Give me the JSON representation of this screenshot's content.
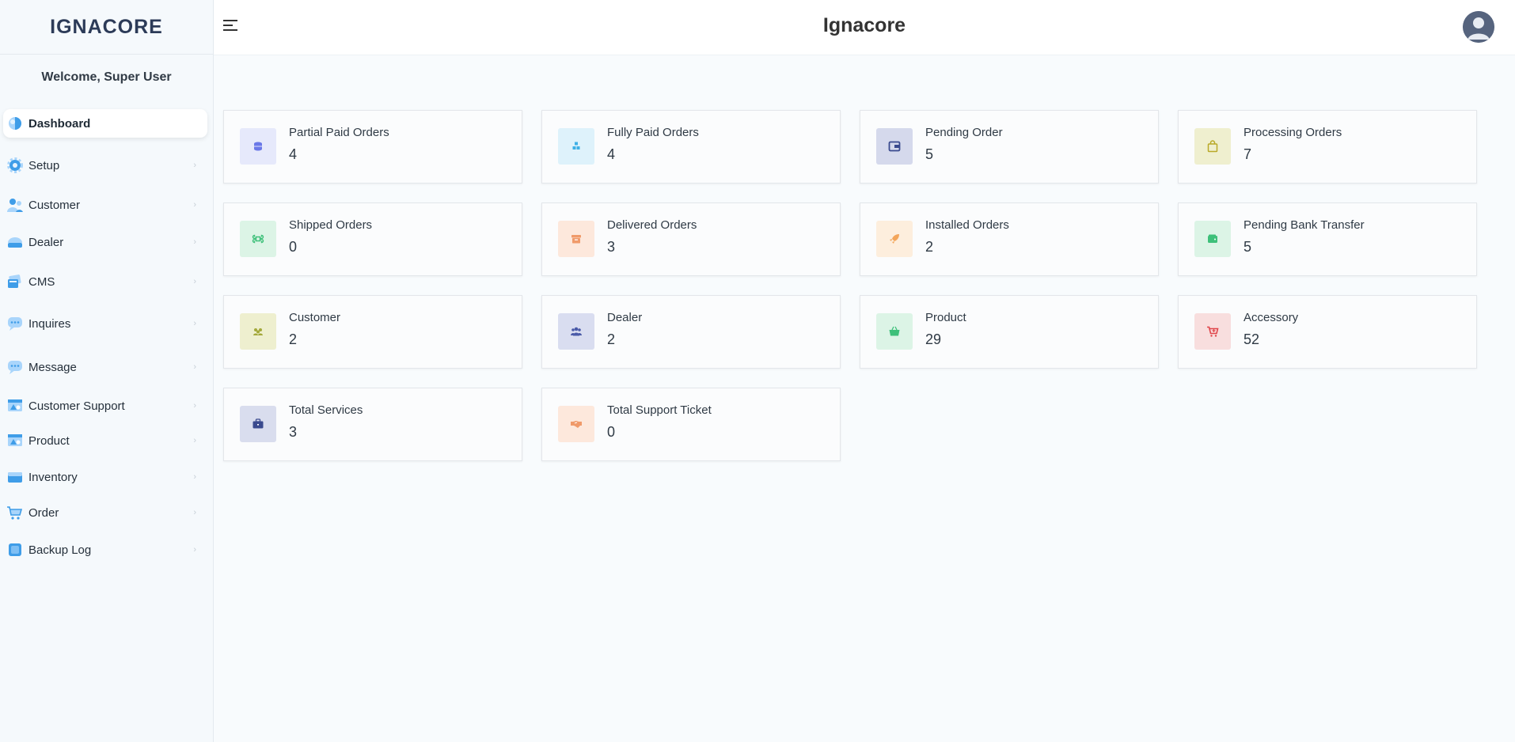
{
  "brand": {
    "logo_text": "IGNACORE",
    "app_title": "Ignacore"
  },
  "sidebar": {
    "welcome": "Welcome, Super User",
    "items": [
      {
        "label": "Dashboard",
        "icon": "dashboard-icon"
      },
      {
        "label": "Setup",
        "icon": "gear-icon"
      },
      {
        "label": "Customer",
        "icon": "customer-icon"
      },
      {
        "label": "Dealer",
        "icon": "dealer-icon"
      },
      {
        "label": "CMS",
        "icon": "cms-icon"
      },
      {
        "label": "Inquires",
        "icon": "chat-icon"
      },
      {
        "label": "Message",
        "icon": "message-icon"
      },
      {
        "label": "Customer Support",
        "icon": "support-icon"
      },
      {
        "label": "Product",
        "icon": "product-icon"
      },
      {
        "label": "Inventory",
        "icon": "inventory-icon"
      },
      {
        "label": "Order",
        "icon": "cart-icon"
      },
      {
        "label": "Backup Log",
        "icon": "backup-icon"
      }
    ]
  },
  "cards": [
    {
      "label": "Partial Paid Orders",
      "value": "4",
      "icon": "coins-icon",
      "color": "#6a78e8",
      "bg": "#e6e9fb"
    },
    {
      "label": "Fully Paid Orders",
      "value": "4",
      "icon": "cubes-icon",
      "color": "#3fb0e6",
      "bg": "#def2fb"
    },
    {
      "label": "Pending Order",
      "value": "5",
      "icon": "wallet-icon",
      "color": "#3a4a8e",
      "bg": "#d5d9ec"
    },
    {
      "label": "Processing Orders",
      "value": "7",
      "icon": "bag-icon",
      "color": "#b9a928",
      "bg": "#efefcf"
    },
    {
      "label": "Shipped Orders",
      "value": "0",
      "icon": "command-icon",
      "color": "#3ec07a",
      "bg": "#dcf4e6"
    },
    {
      "label": "Delivered Orders",
      "value": "3",
      "icon": "box-icon",
      "color": "#f09a6a",
      "bg": "#fde8dc"
    },
    {
      "label": "Installed Orders",
      "value": "2",
      "icon": "rocket-icon",
      "color": "#f3a55a",
      "bg": "#fdeedd"
    },
    {
      "label": "Pending Bank Transfer",
      "value": "5",
      "icon": "wallet-green-icon",
      "color": "#3ec07a",
      "bg": "#dcf4e6"
    },
    {
      "label": "Customer",
      "value": "2",
      "icon": "users-icon",
      "color": "#a3a83a",
      "bg": "#eeefcf"
    },
    {
      "label": "Dealer",
      "value": "2",
      "icon": "group-icon",
      "color": "#4a5aa8",
      "bg": "#d9ddf0"
    },
    {
      "label": "Product",
      "value": "29",
      "icon": "basket-icon",
      "color": "#3ec07a",
      "bg": "#dcf4e6"
    },
    {
      "label": "Accessory",
      "value": "52",
      "icon": "cart-plus-icon",
      "color": "#e0464b",
      "bg": "#f8dede"
    },
    {
      "label": "Total Services",
      "value": "3",
      "icon": "briefcase-icon",
      "color": "#3a4a8e",
      "bg": "#d9ddee"
    },
    {
      "label": "Total Support Ticket",
      "value": "0",
      "icon": "handshake-icon",
      "color": "#f09a6a",
      "bg": "#fde8dc"
    }
  ]
}
